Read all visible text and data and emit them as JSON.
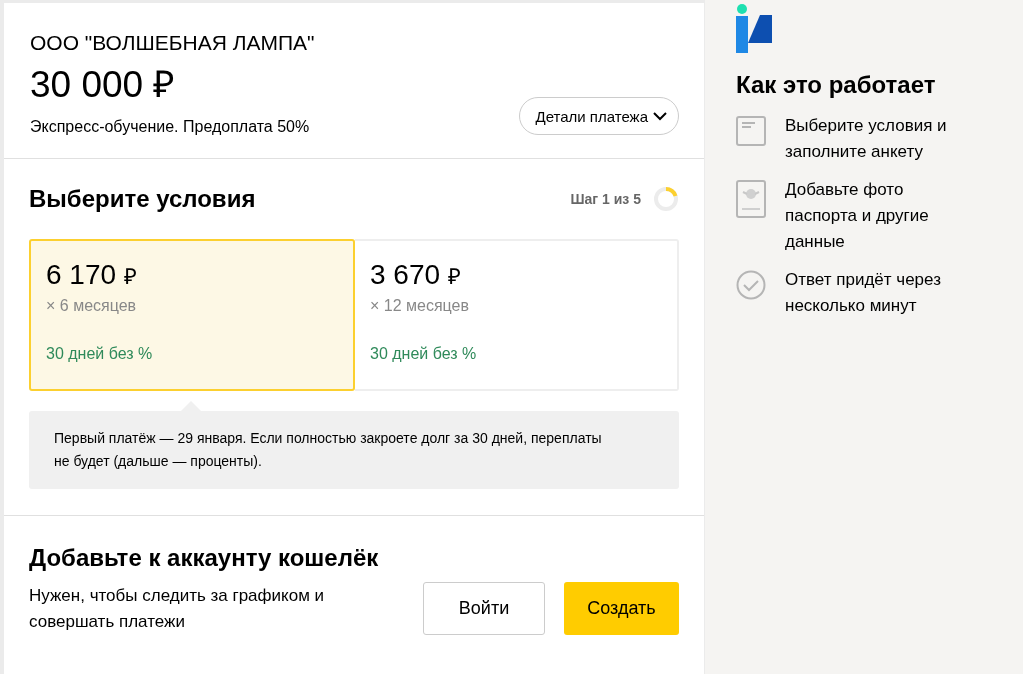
{
  "merchant": {
    "name": "ООО \"ВОЛШЕБНАЯ ЛАМПА\"",
    "amount": "30 000 ₽",
    "description": "Экспресс-обучение. Предоплата 50%",
    "details_button": "Детали платежа"
  },
  "terms": {
    "title": "Выберите условия",
    "step": "Шаг 1 из 5",
    "level": 0.2,
    "options": [
      {
        "payment": "6 170",
        "currency": "₽",
        "period": "× 6 месяцев",
        "promo": "30 дней без %",
        "selected": true
      },
      {
        "payment": "3 670",
        "currency": "₽",
        "period": "× 12 месяцев",
        "promo": "30 дней без %",
        "selected": false
      }
    ],
    "note": "Первый платёж — 29 января. Если полностью закроете долг за 30 дней, переплаты не будет (дальше — проценты)."
  },
  "wallet": {
    "title": "Добавьте к аккаунту кошелёк",
    "text": "Нужен, чтобы следить за графиком и совершать платежи",
    "buttons": [
      {
        "label": "Войти",
        "kind": "secondary"
      },
      {
        "label": "Создать",
        "kind": "primary"
      }
    ]
  },
  "how_it_works": {
    "title": "Как это работает",
    "steps": [
      {
        "kind": "form",
        "text": "Выберите условия и заполните анкету"
      },
      {
        "kind": "passport",
        "text": "Добавьте фото паспорта и другие данные"
      },
      {
        "kind": "check",
        "text": "Ответ придёт через несколько минут"
      }
    ]
  }
}
